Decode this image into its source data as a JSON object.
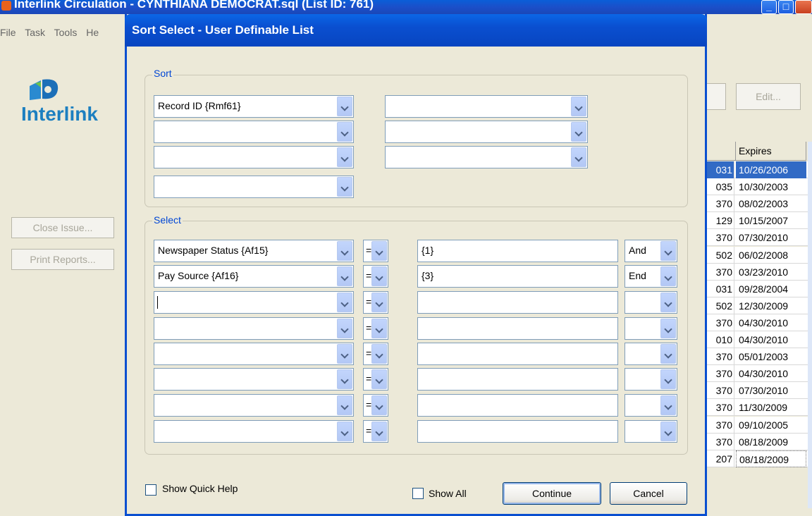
{
  "window": {
    "title": "Interlink Circulation - CYNTHIANA DEMOCRAT.sql (List ID: 761)",
    "minimize": "_",
    "maximize": "□"
  },
  "menu": [
    "File",
    "Task",
    "Tools",
    "He"
  ],
  "logo": {
    "text": "Interlink"
  },
  "sidebar": {
    "close_issue": "Close Issue...",
    "print_reports": "Print Reports..."
  },
  "right_panel": {
    "edit_button": "Edit...",
    "grid": {
      "col1_header": "",
      "col2_header": "Expires",
      "rows": [
        {
          "c1": "031",
          "c2": "10/26/2006",
          "selected": true
        },
        {
          "c1": "035",
          "c2": "10/30/2003"
        },
        {
          "c1": "370",
          "c2": "08/02/2003"
        },
        {
          "c1": "129",
          "c2": "10/15/2007"
        },
        {
          "c1": "370",
          "c2": "07/30/2010"
        },
        {
          "c1": "502",
          "c2": "06/02/2008"
        },
        {
          "c1": "370",
          "c2": "03/23/2010"
        },
        {
          "c1": "031",
          "c2": "09/28/2004"
        },
        {
          "c1": "502",
          "c2": "12/30/2009"
        },
        {
          "c1": "370",
          "c2": "04/30/2010"
        },
        {
          "c1": "010",
          "c2": "04/30/2010"
        },
        {
          "c1": "370",
          "c2": "05/01/2003"
        },
        {
          "c1": "370",
          "c2": "04/30/2010"
        },
        {
          "c1": "370",
          "c2": "07/30/2010"
        },
        {
          "c1": "370",
          "c2": "11/30/2009"
        },
        {
          "c1": "370",
          "c2": "09/10/2005"
        },
        {
          "c1": "370",
          "c2": "08/18/2009"
        },
        {
          "c1": "207",
          "c2": "08/18/2009",
          "boxed": true
        }
      ]
    }
  },
  "dialog": {
    "title": "Sort Select - User Definable List",
    "sort_group": {
      "label": "Sort",
      "fields": [
        "Record ID   {Rmf61}",
        "",
        "",
        "",
        "",
        "",
        ""
      ]
    },
    "select_group": {
      "label": "Select",
      "rows": [
        {
          "field": "Newspaper Status  {Af15}",
          "op": "=",
          "value": "{1}",
          "logic": "And"
        },
        {
          "field": "Pay Source  {Af16}",
          "op": "=",
          "value": "{3}",
          "logic": "End"
        },
        {
          "field": "",
          "op": "=",
          "value": "",
          "logic": ""
        },
        {
          "field": "",
          "op": "=",
          "value": "",
          "logic": ""
        },
        {
          "field": "",
          "op": "=",
          "value": "",
          "logic": ""
        },
        {
          "field": "",
          "op": "=",
          "value": "",
          "logic": ""
        },
        {
          "field": "",
          "op": "=",
          "value": "",
          "logic": ""
        },
        {
          "field": "",
          "op": "=",
          "value": "",
          "logic": ""
        }
      ]
    },
    "show_quick_help": "Show Quick Help",
    "show_all": "Show All",
    "continue": "Continue",
    "cancel": "Cancel"
  },
  "colors": {
    "accent": "#0a4fd0",
    "selection": "#316ac5",
    "group_label": "#0046d5"
  }
}
